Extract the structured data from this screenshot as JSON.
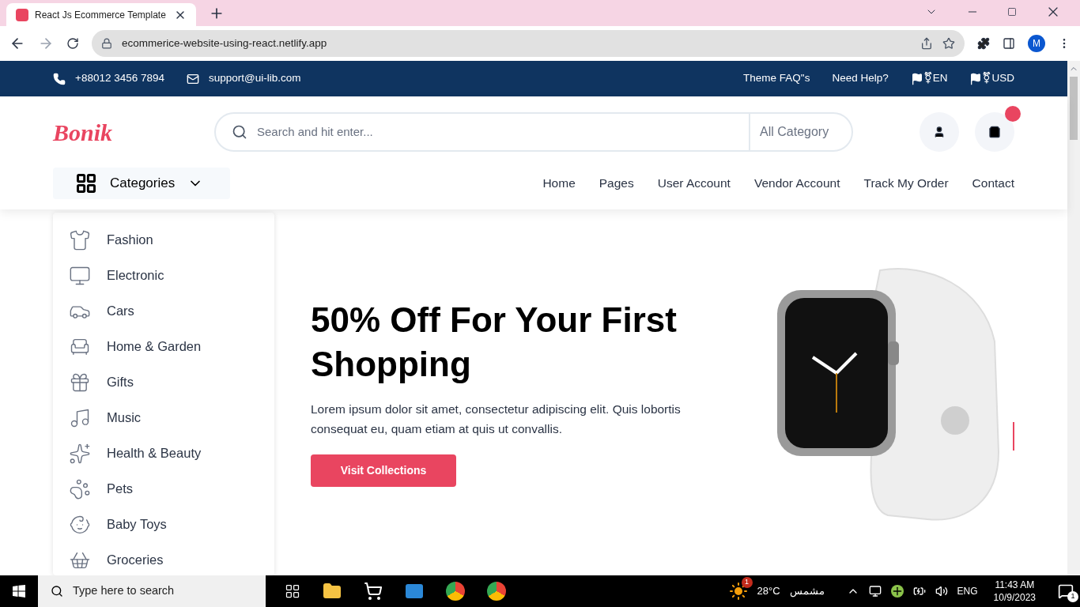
{
  "browser": {
    "tab_title": "React Js Ecommerce Template",
    "url": "ecommerice-website-using-react.netlify.app",
    "profile_initial": "M"
  },
  "topbar": {
    "phone": "+88012 3456 7894",
    "email": "support@ui-lib.com",
    "links": [
      "Theme FAQ\"s",
      "Need Help?"
    ],
    "language": "⚧EN",
    "currency": "⚧USD"
  },
  "header": {
    "logo": "Bonik",
    "search": {
      "placeholder": "Search and hit enter..."
    },
    "category_select": "All Category",
    "cart_badge": true
  },
  "nav": {
    "categories_button": "Categories",
    "items": [
      "Home",
      "Pages",
      "User Account",
      "Vendor Account",
      "Track My Order",
      "Contact"
    ]
  },
  "categories": [
    {
      "label": "Fashion",
      "kind": "fashion"
    },
    {
      "label": "Electronic",
      "kind": "electronic"
    },
    {
      "label": "Cars",
      "kind": "cars"
    },
    {
      "label": "Home & Garden",
      "kind": "home"
    },
    {
      "label": "Gifts",
      "kind": "gifts"
    },
    {
      "label": "Music",
      "kind": "music"
    },
    {
      "label": "Health & Beauty",
      "kind": "health"
    },
    {
      "label": "Pets",
      "kind": "pets"
    },
    {
      "label": "Baby Toys",
      "kind": "baby"
    },
    {
      "label": "Groceries",
      "kind": "groceries"
    }
  ],
  "hero": {
    "title": "50% Off For Your First Shopping",
    "text": "Lorem ipsum dolor sit amet, consectetur adipiscing elit. Quis lobortis consequat eu, quam etiam at quis ut convallis.",
    "button": "Visit Collections"
  },
  "taskbar": {
    "search_placeholder": "Type here to search",
    "weather_badge": "1",
    "temperature": "28°C",
    "weather": "مشمس",
    "language": "ENG",
    "time": "11:43 AM",
    "date": "10/9/2023",
    "notifications": "1"
  }
}
